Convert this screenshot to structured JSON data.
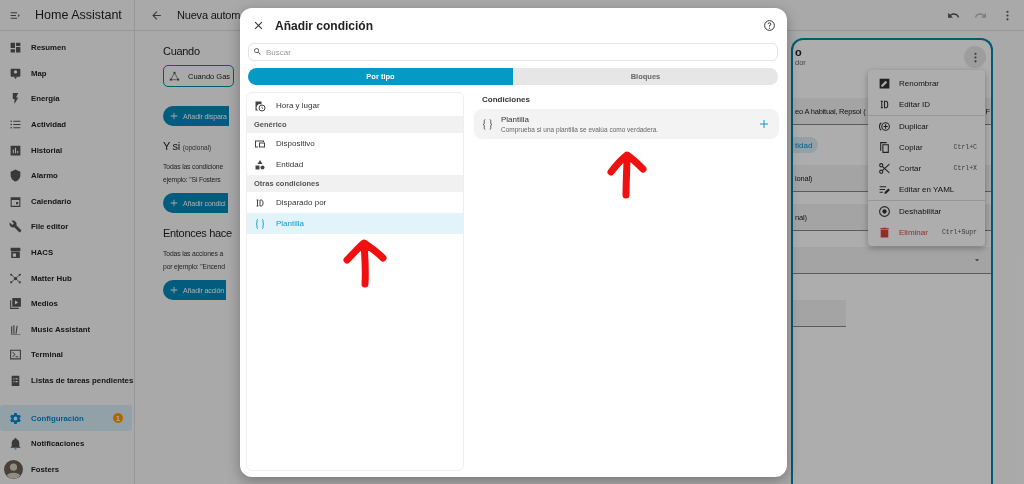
{
  "sidebar": {
    "title": "Home Assistant",
    "items": [
      {
        "label": "Resumen",
        "selected": false
      },
      {
        "label": "Map",
        "selected": false
      },
      {
        "label": "Energía",
        "selected": false
      },
      {
        "label": "Actividad",
        "selected": false
      },
      {
        "label": "Historial",
        "selected": false
      },
      {
        "label": "Alarmo",
        "selected": false
      },
      {
        "label": "Calendario",
        "selected": false
      },
      {
        "label": "File editor",
        "selected": false
      },
      {
        "label": "HACS",
        "selected": false
      },
      {
        "label": "Matter Hub",
        "selected": false
      },
      {
        "label": "Medios",
        "selected": false
      },
      {
        "label": "Music Assistant",
        "selected": false
      },
      {
        "label": "Terminal",
        "selected": false
      },
      {
        "label": "Listas de tareas pendientes",
        "selected": false
      }
    ],
    "bottom_items": [
      {
        "label": "Configuración",
        "selected": true,
        "badge": "1"
      },
      {
        "label": "Notificaciones",
        "selected": false
      }
    ],
    "user": {
      "name": "Fosters"
    }
  },
  "topbar": {
    "title": "Nueva autom"
  },
  "editor": {
    "sections": [
      {
        "title": "Cuando",
        "items": [
          "Cuando Gas"
        ],
        "button": "Añadir dispara"
      },
      {
        "title": "Y si",
        "optional": "(opcional)",
        "description": [
          "Todas las condicione",
          "ejemplo: \"Si Fosters"
        ],
        "button": "Añadir condici"
      },
      {
        "title": "Entonces hace",
        "description": [
          "Todas las acciones a",
          "por ejemplo: \"Encend"
        ],
        "button": "Añadir acción"
      }
    ]
  },
  "card": {
    "title": "o",
    "subtitle": "dor",
    "fields": [
      {
        "kind": "text",
        "value": "eo A habitual, Repsol (",
        "tail": "F"
      },
      {
        "kind": "chip",
        "value": "tidad"
      },
      {
        "kind": "text",
        "value": "ional)"
      },
      {
        "kind": "text",
        "value": "nal)"
      },
      {
        "kind": "select"
      },
      {
        "kind": "time"
      }
    ]
  },
  "menu": {
    "groups": [
      [
        {
          "label": "Renombrar",
          "kind": "normal"
        },
        {
          "label": "Editar ID",
          "kind": "normal"
        }
      ],
      [
        {
          "label": "Duplicar",
          "kind": "normal"
        },
        {
          "label": "Copiar",
          "kind": "normal",
          "shortcut": "Ctrl+C"
        },
        {
          "label": "Cortar",
          "kind": "normal",
          "shortcut": "Ctrl+X"
        },
        {
          "label": "Editar en YAML",
          "kind": "normal"
        }
      ],
      [
        {
          "label": "Deshabilitar",
          "kind": "normal"
        },
        {
          "label": "Eliminar",
          "kind": "danger",
          "shortcut": "Ctrl+Supr"
        }
      ]
    ]
  },
  "dialog": {
    "title": "Añadir condición",
    "search": {
      "placeholder": "Buscar"
    },
    "tabs": [
      {
        "label": "Por tipo",
        "selected": true
      },
      {
        "label": "Bloques",
        "selected": false
      }
    ],
    "list": [
      {
        "kind": "item",
        "label": "Hora y lugar",
        "selected": false
      },
      {
        "kind": "header",
        "label": "Genérico"
      },
      {
        "kind": "item",
        "label": "Dispositivo",
        "selected": false
      },
      {
        "kind": "item",
        "label": "Entidad",
        "selected": false
      },
      {
        "kind": "header",
        "label": "Otras condiciones"
      },
      {
        "kind": "item",
        "label": "Disparado por",
        "selected": false
      },
      {
        "kind": "item",
        "label": "Plantilla",
        "selected": true
      }
    ],
    "results": {
      "heading": "Condiciones",
      "items": [
        {
          "title": "Plantilla",
          "description": "Comprueba si una plantilla se evalúa como verdadera."
        }
      ]
    }
  }
}
